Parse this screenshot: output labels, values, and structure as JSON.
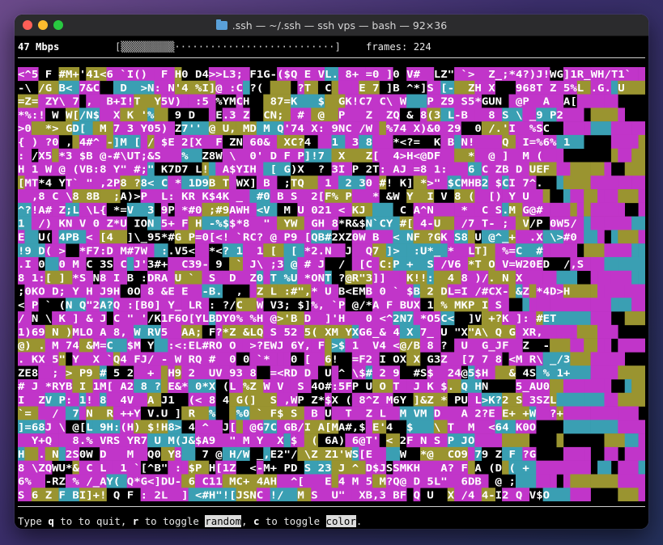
{
  "window": {
    "title": ".ssh — ~/.ssh — ssh vps — bash — 92×36",
    "icon": "folder-icon"
  },
  "status": {
    "rate": "47 Mbps",
    "progress": "[▒▒▒▒▒▒▒▒▒···························]",
    "frames": "frames: 224"
  },
  "help": {
    "pre": "Type ",
    "quit_key": "q",
    "quit_text": " to to quit, ",
    "random_key": "r",
    "random_text": " to toggle ",
    "random_word": "random",
    "mid": ", ",
    "color_key": "c",
    "color_text": " to toggle ",
    "color_word": "color",
    "end": "."
  },
  "matrix": {
    "rows": [
      "<^5 F #M+'41<6 `I()  F H0 D4>>L3; F1G-($Q E VL. 8+ =0 ]0 V#  LZ\" `>  Z_;*4?)J!WG]1R_WH/T1`",
      "-\\ /G B< 7&C   D  >N: N'4 %I]@ :C ?(     ?T  C    E 7 ]B ^*]S [-  ZH X   968T Z 5%L .G. U",
      "=Z= ZY\\ 7 ,  B+I!T  Y5V)  :5 %YMCH   87=K   $  GK!C7 C\\ W   P Z9 S5*GUN  @P  A  A[",
      "*%:! W W[/N$  X K '%   9 D   E.3 Z  CN;  #  @  P   Z  ZQ & 8(3 L-B   8 S \\ _9 P2",
      ">0  *> GD[  M 7 3 Y05) Z7'' @ U, MD M Q'74 X: 9NC /W  %74 X)&0 29  0 /.'I  %SC",
      "{ ) ?0 , 4#^ -]M [ / $E 2[X  F ZN 60&  XC?4   1  3 8   *<?=  K B N!    Q  I=%6% 1",
      ": /X5 *3 $B @-#\\UT;&S   %  Z8W \\  0' D F P]!7  X   Z[  4>H<@DF    *  @ ]  M (",
      "H 1 W @ (VB:8 Y\" #;\" K7D7 L!  A$YIH  [ G)X  ? 3I P 2T: AJ =8 1:   6 C ZB D UEF",
      "[MT*4 YT` \" ,2P8 ?8< C * 1D9B T WX] B  ;TQ   1  2 30 #! K] *>\" $CMHB2 $CI 7^.",
      "  ,8 C \\8 8B  ;A)>P  L: KR K$4K _  #0 B S  2[F% P   * &W Y  I V 8 (  [) Y U",
      "^?!A# Z;L \\L{ *=V  3 9P *#0 ;#9AWH <V  M U 021 < KJ     C A^N    *  C S.M G@#",
      "1  /) KN V 0 Z*U ION 5+ F H -%$$*8  \"  YW  GH 8*R&$N`CY #[ 4-U   /7 T- ;  V/P 0W5/",
      "E  U( 4PB < [4  ]\\_95*#G P=0[<! `RC? @ P9 [QB#2XZ0W B  < NF ?GK S8 U @^_+  .X \\>#0",
      "!9 D( >  *F7:D M#7W  :.V5<  *<? 1  1 [  [ *2.N  J  Q7 ]>  :U*_ *  LT]  %=C  #",
      ".I 0  0 M C 3S C J'3#+  C39- 9  ` J\\ ;3 @ # J  /  [C C:P +  S /V6 *T O V=W20ED  /,S",
      "8 1:[ ] *S N8 I B :DRA U `  S  D  Z0 T %U *ONT ?@R\"3]]   K!!:  4 8 )/. N X",
      ";0KO D; Y H J9H 0O 8 &E E  -B.  ,  Z L :#\",* U B<EMB 0 ` $B 2 DL=I /#CX- &Z *4D>H",
      "< P ` (N Q\"2A?Q :[B0] Y_ LR : ?/C  W V3; $]%, `P @/*A F BUX 1 % MKP I S",
      "/ N \\ K ] & J C \" '/K1F6O[YLBDY0% %H @>'B D  ]'H   0 <^2N7 *O5C<  ]V +?K ]: #ET",
      "1)69 N )MLO A 8, W RV5  AA; F?*Z &LQ S 52 5( XM YXG6_& 4 X 7_ U \"X\"A\\ Q G XR,",
      "@) . M 74 &M=C  $M Y  :<:EL#RO O  >?EWJ 6Y, F >$ 1  V4 <@/B 8 ?  U  G_JF  Z  -",
      ". KX 5\" Y  X `Q4 FJ/ - W RQ #  0 0 `*   0 [  6!  =F2 I OX X G3Z  [7 7 8 <M R\\ _/3",
      "ZE8  ; > P9 # 5 2  +  H9 2  UV 93 8  =<RD D  U ^ \\$# 2 9  #S$  24@5$H   & 4S % 1+",
      "# J *RYB I 1M[ A2 8 ? E&* 0*X (L %Z W V  S 4O#:5FP U O T  J K $. Q HN    5_AU0",
      "I  ZV P: 1! 8  4V  A J1  (< 8 4 G(]  S ,WP Z*$X ( 8^Z M6Y ]&Z * PU L>K?2 S 3SZL",
      "`=   /  7 N  R ++Y V.U ] R  %   %0 ` F$ S  B U  T  Z L  M VM D   A 2?E E+ +W  ?+",
      "]=68J \\ @[L 9H:(H) $!H8> 4 ^  J[  @G7C GB/I A[MA#,$ E'4  $   \\ T  M  <64 K0O",
      "  Y+Q   8.% VRS YR7 U M(J&$A9  \" M Y  X $  ( 6A) 6@T' < 2F N S P JO",
      "H  . N 2S0W D   M  Q0 Y8   7 @ H/W _,E2\"/ \\Z Z1'WS[E    W  *@  CO9 79 Z F ?G",
      "8 \\ZQWU*& C L  1 `[^B\" : $P H[1Z  <-M+ PD S 23 J ^ D$JSSMKH   A? F A (D ( +",
      "6%  -RZ % /_AY( Q*G<]DU- 6 C11 MC+ 4AH  ^[   E 4 M 5 M?Q@ D 5L\"  6DB  @ ;",
      "S 6 Z F BI]+! Q F : 2L  ] <#H\"![JSNC !/  M S  U\"  XB,3 BF Q U  X /4 4-I2 Q V$O"
    ],
    "colors": {
      "magenta": "#c135c9",
      "cyan": "#3a9fb3",
      "olive": "#9a9430",
      "blank": "#000000",
      "text": "#ffffff"
    }
  }
}
